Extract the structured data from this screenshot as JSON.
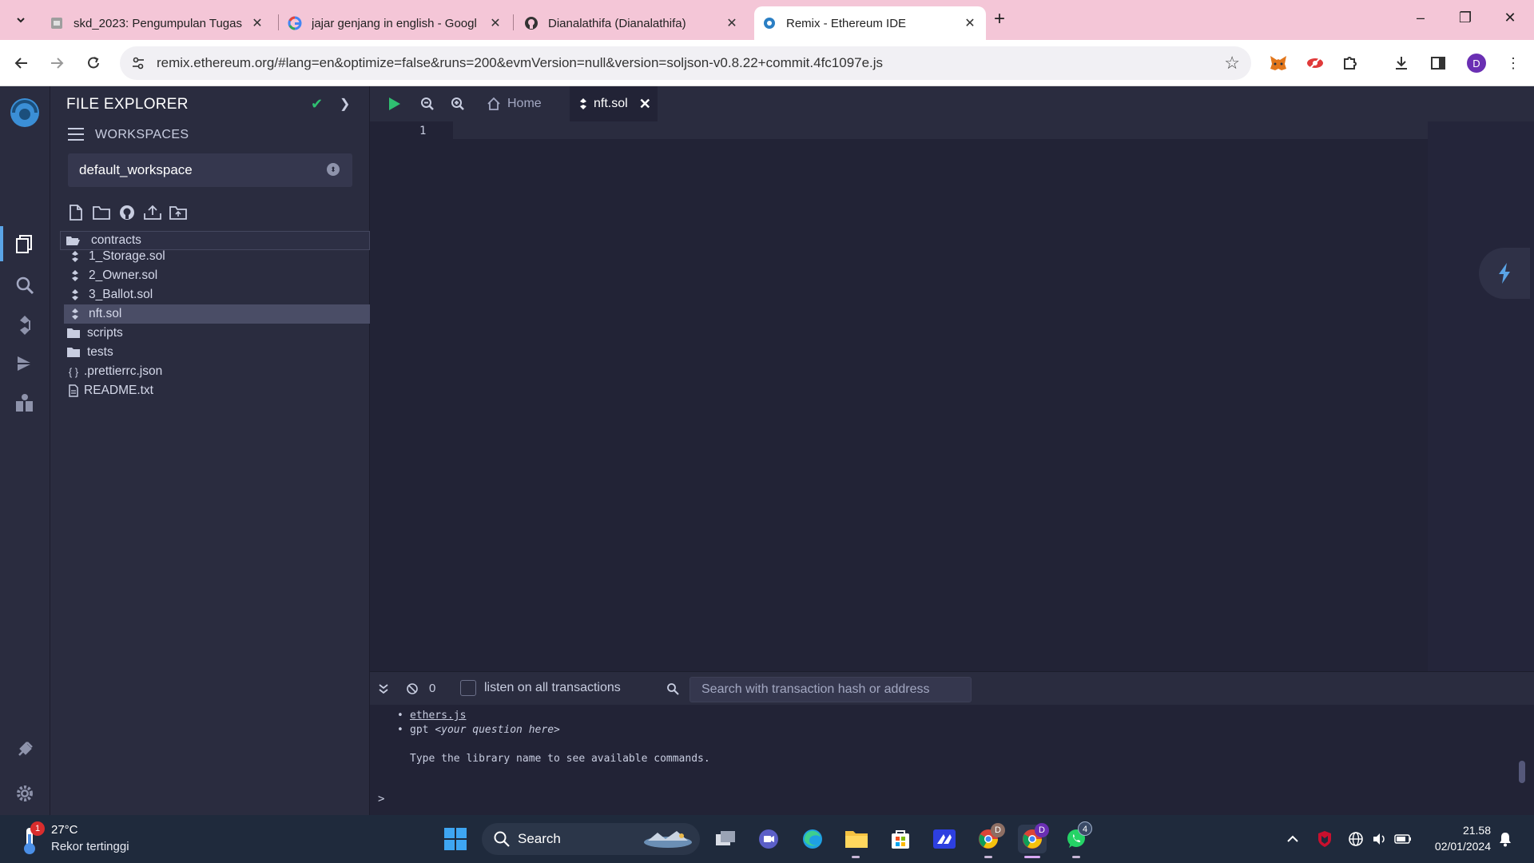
{
  "browser": {
    "tabs": [
      {
        "title": "skd_2023: Pengumpulan Tugas",
        "icon": "moodle-icon"
      },
      {
        "title": "jajar genjang in english - Googl",
        "icon": "google-icon"
      },
      {
        "title": "Dianalathifa (Dianalathifa)",
        "icon": "github-icon"
      },
      {
        "title": "Remix - Ethereum IDE",
        "icon": "remix-icon",
        "active": true
      }
    ],
    "url": "remix.ethereum.org/#lang=en&optimize=false&runs=200&evmVersion=null&version=soljson-v0.8.22+commit.4fc1097e.js",
    "profile_initial": "D"
  },
  "sidepanel": {
    "title": "FILE EXPLORER",
    "workspaces_label": "WORKSPACES",
    "workspace": "default_workspace",
    "tree": [
      {
        "label": "contracts",
        "type": "folder-open"
      },
      {
        "label": "1_Storage.sol",
        "type": "sol"
      },
      {
        "label": "2_Owner.sol",
        "type": "sol"
      },
      {
        "label": "3_Ballot.sol",
        "type": "sol"
      },
      {
        "label": "nft.sol",
        "type": "sol",
        "selected": true
      },
      {
        "label": "scripts",
        "type": "folder"
      },
      {
        "label": "tests",
        "type": "folder"
      },
      {
        "label": ".prettierrc.json",
        "type": "json"
      },
      {
        "label": "README.txt",
        "type": "txt"
      }
    ]
  },
  "editor": {
    "tabs": [
      {
        "label": "Home",
        "icon": "home-icon"
      },
      {
        "label": "nft.sol",
        "icon": "solidity-icon",
        "active": true
      }
    ],
    "line_number": "1"
  },
  "terminal": {
    "count": "0",
    "listen_label": "listen on all transactions",
    "search_placeholder": "Search with transaction hash or address",
    "lines": {
      "ethers": "ethers.js",
      "gpt_cmd": "gpt",
      "gpt_arg": "<your question here>",
      "hint": "Type the library name to see available commands."
    },
    "prompt": ">"
  },
  "taskbar": {
    "temperature": "27°C",
    "condition": "Rekor tertinggi",
    "weather_badge": "1",
    "search_label": "Search",
    "time": "21.58",
    "date": "02/01/2024",
    "whatsapp_badge": "4"
  },
  "colors": {
    "accent": "#5aa4e6",
    "success": "#2fbf71",
    "tabstrip": "#f4c6d7"
  }
}
